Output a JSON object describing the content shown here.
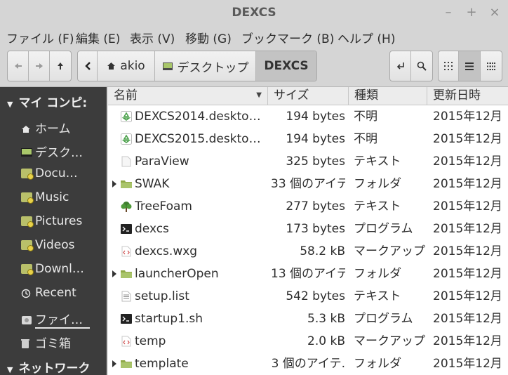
{
  "window": {
    "title": "DEXCS"
  },
  "menu": [
    "ファイル (F)",
    "編集 (E)",
    "表示 (V)",
    "移動 (G)",
    "ブックマーク (B)",
    "ヘルプ (H)"
  ],
  "breadcrumbs": [
    "akio",
    "デスクトップ",
    "DEXCS"
  ],
  "sidebar": {
    "section_computer": "マイ コンピ:",
    "items": [
      "ホーム",
      "デスク…",
      "Docu…",
      "Music",
      "Pictures",
      "Videos",
      "Downl…",
      "Recent",
      "ファイ…",
      "ゴミ箱"
    ],
    "section_network": "ネットワーク"
  },
  "columns": {
    "name": "名前",
    "size": "サイズ",
    "type": "種類",
    "date": "更新日時"
  },
  "files": [
    {
      "name": "DEXCS2014.deskto…",
      "size": "194 bytes",
      "type": "不明",
      "date": "2015年12月",
      "icon": "recycle-icon"
    },
    {
      "name": "DEXCS2015.deskto…",
      "size": "194 bytes",
      "type": "不明",
      "date": "2015年12月",
      "icon": "recycle-icon"
    },
    {
      "name": "ParaView",
      "size": "325 bytes",
      "type": "テキスト",
      "date": "2015年12月",
      "icon": "blank-file-icon"
    },
    {
      "name": "SWAK",
      "size": "33 個のアイテ",
      "type": "フォルダ",
      "date": "2015年12月",
      "icon": "folder-icon"
    },
    {
      "name": "TreeFoam",
      "size": "277 bytes",
      "type": "テキスト",
      "date": "2015年12月",
      "icon": "tree-icon"
    },
    {
      "name": "dexcs",
      "size": "173 bytes",
      "type": "プログラム",
      "date": "2015年12月",
      "icon": "terminal-icon"
    },
    {
      "name": "dexcs.wxg",
      "size": "58.2 kB",
      "type": "マークアップ",
      "date": "2015年12月",
      "icon": "markup-icon"
    },
    {
      "name": "launcherOpen",
      "size": "13 個のアイテ",
      "type": "フォルダ",
      "date": "2015年12月",
      "icon": "folder-icon"
    },
    {
      "name": "setup.list",
      "size": "542 bytes",
      "type": "テキスト",
      "date": "2015年12月",
      "icon": "text-file-icon"
    },
    {
      "name": "startup1.sh",
      "size": "5.3 kB",
      "type": "プログラム",
      "date": "2015年12月",
      "icon": "terminal-icon"
    },
    {
      "name": "temp",
      "size": "2.0 kB",
      "type": "マークアップ",
      "date": "2015年12月",
      "icon": "markup-icon"
    },
    {
      "name": "template",
      "size": "3 個のアイテ.",
      "type": "フォルダ",
      "date": "2015年12月",
      "icon": "folder-icon"
    }
  ]
}
